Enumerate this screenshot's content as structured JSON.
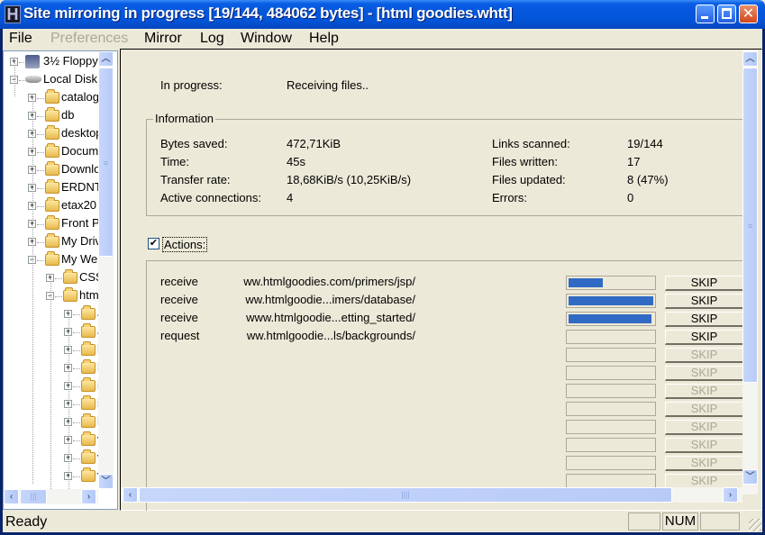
{
  "window": {
    "title": "Site mirroring in progress [19/144, 484062 bytes] - [html goodies.whtt]",
    "app_icon_letter": "H",
    "controls": {
      "minimize": "minimize-icon",
      "maximize": "maximize-icon",
      "close": "close-icon",
      "close_glyph": "✕"
    }
  },
  "menu": [
    {
      "label": "File",
      "enabled": true
    },
    {
      "label": "Preferences",
      "enabled": false
    },
    {
      "label": "Mirror",
      "enabled": true
    },
    {
      "label": "Log",
      "enabled": true
    },
    {
      "label": "Window",
      "enabled": true
    },
    {
      "label": "Help",
      "enabled": true
    }
  ],
  "tree": {
    "items": [
      {
        "label": "3½ Floppy",
        "icon": "floppy-icon",
        "expander": "+",
        "level": 0
      },
      {
        "label": "Local Disk",
        "icon": "drive-icon",
        "expander": "−",
        "level": 0
      },
      {
        "label": "catalog",
        "icon": "folder-icon",
        "expander": "+",
        "level": 1
      },
      {
        "label": "db",
        "icon": "folder-icon",
        "expander": "+",
        "level": 1
      },
      {
        "label": "desktop",
        "icon": "folder-icon",
        "expander": "+",
        "level": 1
      },
      {
        "label": "Documents",
        "icon": "folder-icon",
        "expander": "+",
        "level": 1
      },
      {
        "label": "Downloads",
        "icon": "folder-icon",
        "expander": "+",
        "level": 1
      },
      {
        "label": "ERDNT",
        "icon": "folder-icon",
        "expander": "+",
        "level": 1
      },
      {
        "label": "etax20",
        "icon": "folder-icon",
        "expander": "+",
        "level": 1
      },
      {
        "label": "Front P",
        "icon": "folder-icon",
        "expander": "+",
        "level": 1
      },
      {
        "label": "My Driv",
        "icon": "folder-icon",
        "expander": "+",
        "level": 1
      },
      {
        "label": "My We",
        "icon": "folder-icon",
        "expander": "−",
        "level": 1
      },
      {
        "label": "CSS",
        "icon": "folder-icon",
        "expander": "+",
        "level": 2
      },
      {
        "label": "htm",
        "icon": "folder-icon",
        "expander": "−",
        "level": 2
      },
      {
        "label": "a",
        "icon": "folder-icon",
        "expander": "+",
        "level": 3
      },
      {
        "label": "a",
        "icon": "folder-icon",
        "expander": "+",
        "level": 3
      },
      {
        "label": "h",
        "icon": "folder-icon",
        "expander": "+",
        "level": 3
      },
      {
        "label": "h",
        "icon": "folder-icon",
        "expander": "+",
        "level": 3
      },
      {
        "label": "i",
        "icon": "folder-icon",
        "expander": "+",
        "level": 3
      },
      {
        "label": "i",
        "icon": "folder-icon",
        "expander": "+",
        "level": 3
      },
      {
        "label": "ii",
        "icon": "folder-icon",
        "expander": "+",
        "level": 3
      },
      {
        "label": "v",
        "icon": "folder-icon",
        "expander": "+",
        "level": 3
      },
      {
        "label": "v",
        "icon": "folder-icon",
        "expander": "+",
        "level": 3
      },
      {
        "label": "v",
        "icon": "folder-icon",
        "expander": "+",
        "level": 3
      }
    ]
  },
  "progress": {
    "label": "In progress:",
    "value": "Receiving files.."
  },
  "information": {
    "title": "Information",
    "left": [
      {
        "label": "Bytes saved:",
        "value": "472,71KiB"
      },
      {
        "label": "Time:",
        "value": "45s"
      },
      {
        "label": "Transfer rate:",
        "value": "18,68KiB/s (10,25KiB/s)"
      },
      {
        "label": "Active connections:",
        "value": "4"
      }
    ],
    "right": [
      {
        "label": "Links scanned:",
        "value": "19/144"
      },
      {
        "label": "Files written:",
        "value": "17"
      },
      {
        "label": "Files updated:",
        "value": "8 (47%)"
      },
      {
        "label": "Errors:",
        "value": "0"
      }
    ]
  },
  "actions": {
    "label": "Actions:",
    "checked": true,
    "skip_label": "SKIP",
    "rows": [
      {
        "action": "receive",
        "url": "ww.htmlgoodies.com/primers/jsp/",
        "progress": 0.4,
        "skip_enabled": true
      },
      {
        "action": "receive",
        "url": "ww.htmlgoodie...imers/database/",
        "progress": 0.98,
        "skip_enabled": true
      },
      {
        "action": "receive",
        "url": "www.htmlgoodie...etting_started/",
        "progress": 0.96,
        "skip_enabled": true
      },
      {
        "action": "request",
        "url": "ww.htmlgoodie...ls/backgrounds/",
        "progress": 0,
        "skip_enabled": true
      },
      {
        "action": "",
        "url": "",
        "progress": 0,
        "skip_enabled": false
      },
      {
        "action": "",
        "url": "",
        "progress": 0,
        "skip_enabled": false
      },
      {
        "action": "",
        "url": "",
        "progress": 0,
        "skip_enabled": false
      },
      {
        "action": "",
        "url": "",
        "progress": 0,
        "skip_enabled": false
      },
      {
        "action": "",
        "url": "",
        "progress": 0,
        "skip_enabled": false
      },
      {
        "action": "",
        "url": "",
        "progress": 0,
        "skip_enabled": false
      },
      {
        "action": "",
        "url": "",
        "progress": 0,
        "skip_enabled": false
      },
      {
        "action": "",
        "url": "",
        "progress": 0,
        "skip_enabled": false
      }
    ]
  },
  "status": {
    "text": "Ready",
    "panels": [
      "",
      "NUM",
      ""
    ]
  },
  "colors": {
    "progress_fill": "#316ac5",
    "titlebar": "#0355d8"
  }
}
